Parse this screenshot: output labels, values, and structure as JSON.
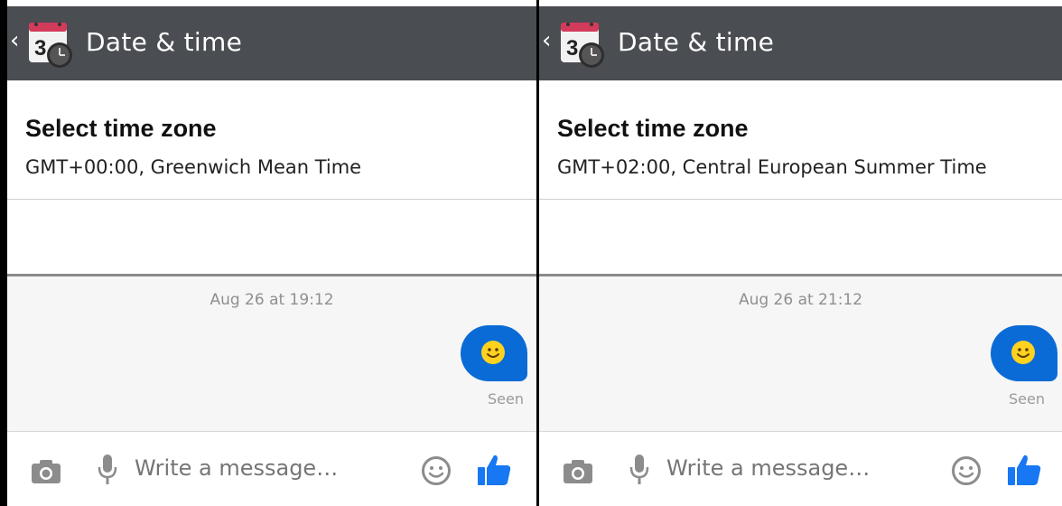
{
  "panels": [
    {
      "header": {
        "title": "Date & time",
        "back_icon": "chevron-left-icon",
        "app_icon": "calendar-clock-icon"
      },
      "timezone": {
        "title": "Select time zone",
        "subtitle": "GMT+00:00, Greenwich Mean Time"
      },
      "chat": {
        "timestamp": "Aug 26 at 19:12",
        "status": "Seen"
      },
      "composer": {
        "placeholder": "Write a message…"
      }
    },
    {
      "header": {
        "title": "Date & time",
        "back_icon": "chevron-left-icon",
        "app_icon": "calendar-clock-icon"
      },
      "timezone": {
        "title": "Select time zone",
        "subtitle": "GMT+02:00, Central European Summer Time"
      },
      "chat": {
        "timestamp": "Aug 26 at 21:12",
        "status": "Seen"
      },
      "composer": {
        "placeholder": "Write a message…"
      }
    }
  ],
  "colors": {
    "header_bg": "#4a4d52",
    "bubble": "#0a6bd6",
    "like": "#1877f2",
    "emoji": "#ffd21f"
  }
}
